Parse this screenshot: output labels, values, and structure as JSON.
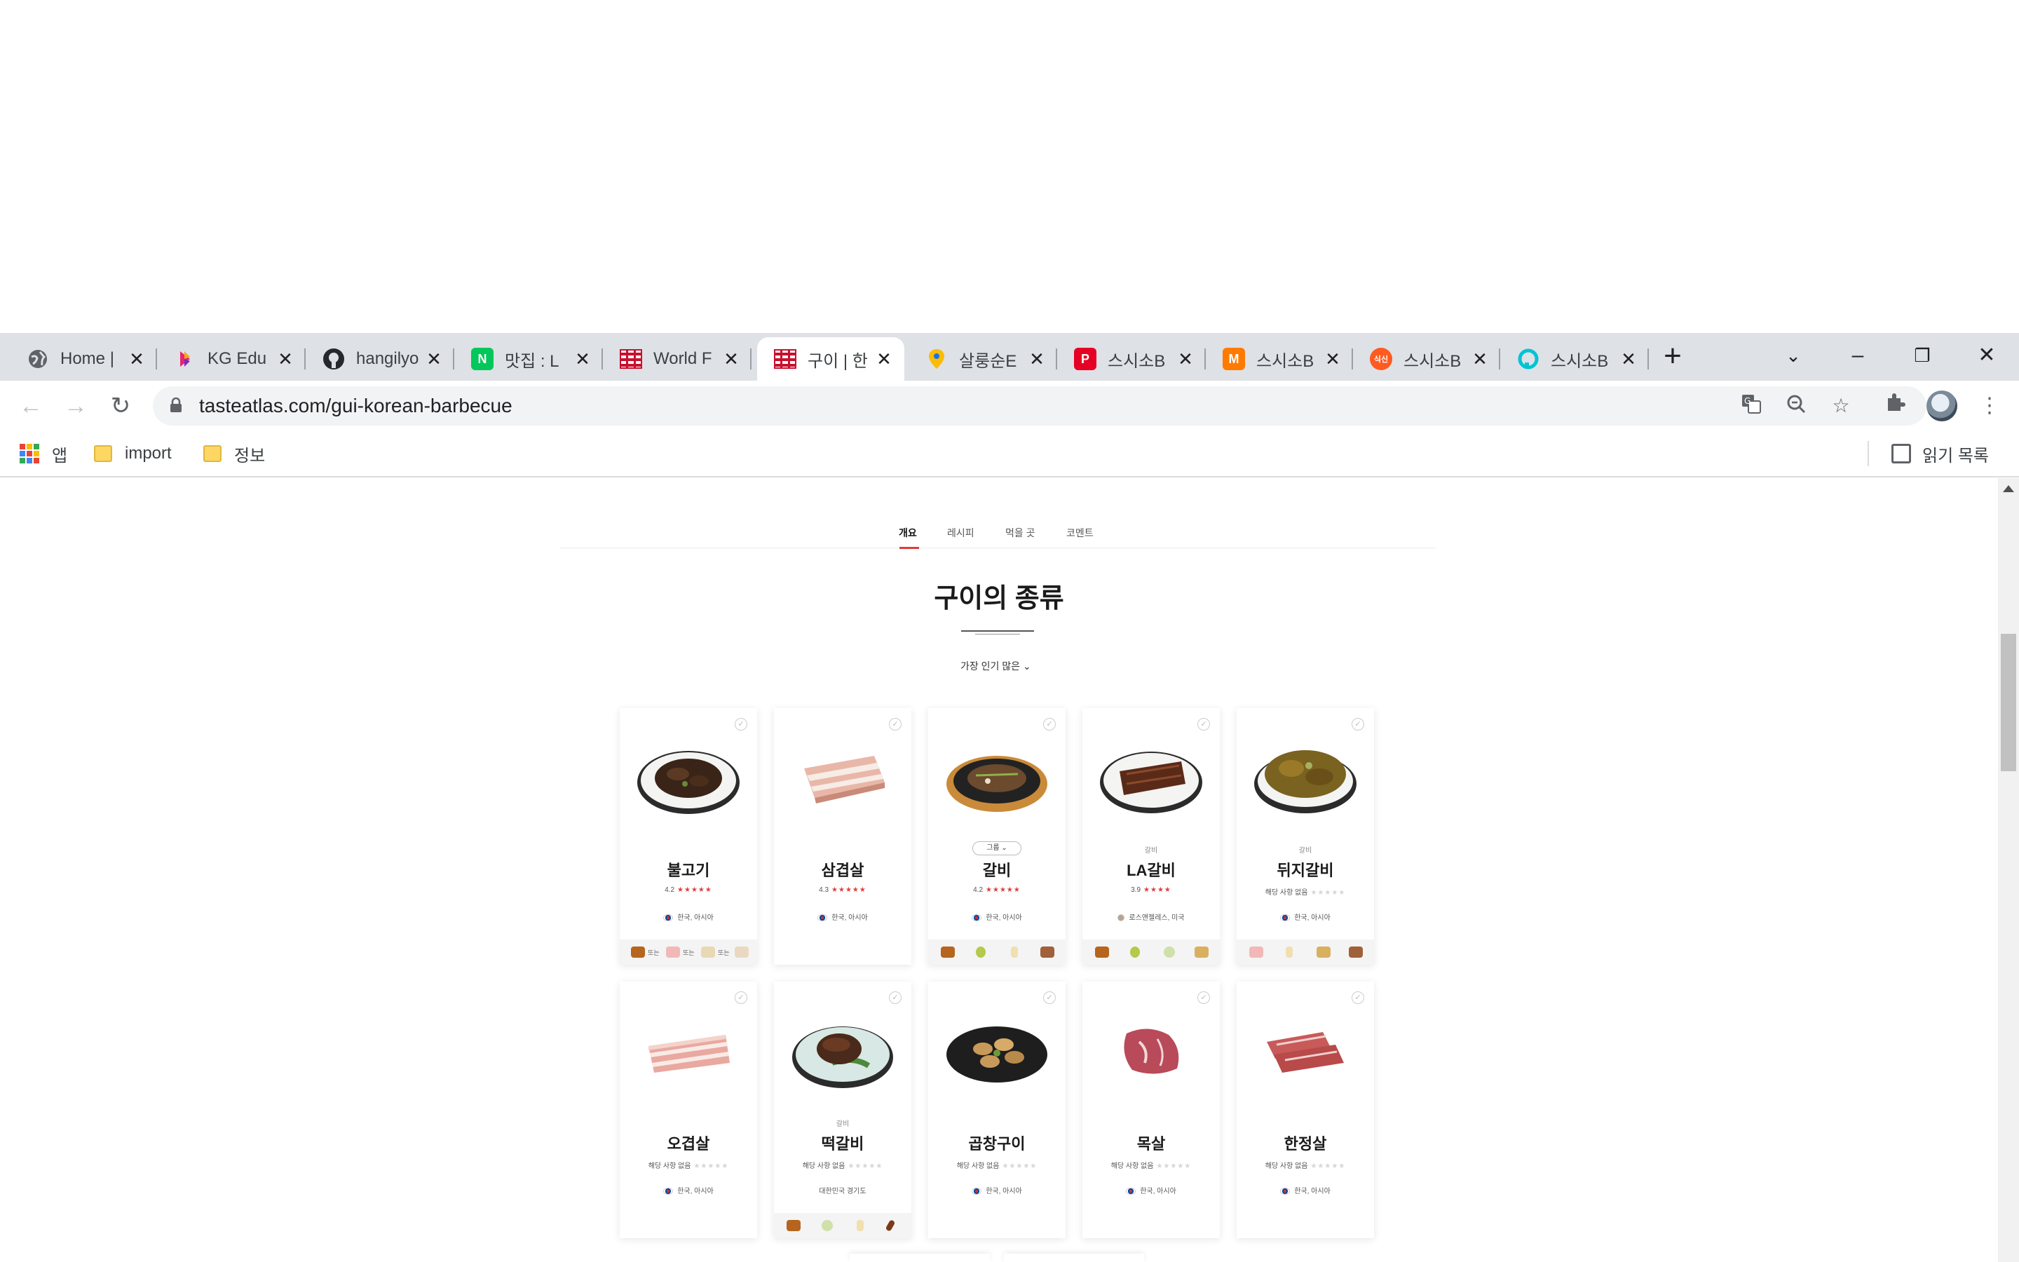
{
  "browser": {
    "tabs": [
      {
        "title": "Home |",
        "icon": "globe-icon",
        "color": "#5f6368"
      },
      {
        "title": "KG Edu",
        "icon": "kg-logo-icon",
        "color": "#e8256f"
      },
      {
        "title": "hangilyo",
        "icon": "github-icon",
        "color": "#24292e"
      },
      {
        "title": "맛집 : L",
        "icon": "naver-icon",
        "color": "#03c75a"
      },
      {
        "title": "World F",
        "icon": "tasteatlas-icon",
        "color": "#c8102e"
      },
      {
        "title": "구이 | 한",
        "icon": "tasteatlas-icon",
        "color": "#c8102e",
        "active": true
      },
      {
        "title": "살룽순E",
        "icon": "map-pin-icon",
        "color": "#fbbc04"
      },
      {
        "title": "스시소B",
        "icon": "p-logo-icon",
        "color": "#e60023"
      },
      {
        "title": "스시소B",
        "icon": "m-logo-icon",
        "color": "#ff7a00"
      },
      {
        "title": "스시소B",
        "icon": "siksin-logo-icon",
        "color": "#ff5a1f"
      },
      {
        "title": "스시소B",
        "icon": "d-logo-icon",
        "color": "#00c4d4"
      }
    ],
    "url": "tasteatlas.com/gui-korean-barbecue",
    "bookmarks": {
      "apps": "앱",
      "items": [
        "import",
        "정보"
      ],
      "reading_list": "읽기 목록"
    }
  },
  "page": {
    "subnav": [
      "개요",
      "레시피",
      "먹을 곳",
      "코멘트"
    ],
    "section_title": "구이의 종류",
    "sort_label": "가장 인기 많은",
    "cards": [
      {
        "name": "불고기",
        "rating": "4.2",
        "stars": "★★★★★",
        "origin": "한국, 아시아",
        "ingredients_text": [
          "또는",
          "또는",
          "또는"
        ]
      },
      {
        "name": "삼겹살",
        "rating": "4.3",
        "stars": "★★★★★",
        "origin": "한국, 아시아"
      },
      {
        "name": "갈비",
        "group": "그룹",
        "rating": "4.2",
        "stars": "★★★★★",
        "origin": "한국, 아시아"
      },
      {
        "name": "LA갈비",
        "parent": "갈비",
        "rating": "3.9",
        "stars": "★★★★",
        "origin": "로스앤젤레스, 미국"
      },
      {
        "name": "뒤지갈비",
        "parent": "갈비",
        "rating": "해당 사항 없음",
        "stars": "★★★★★",
        "origin": "한국, 아시아"
      },
      {
        "name": "오겹살",
        "rating": "해당 사항 없음",
        "stars": "★★★★★",
        "origin": "한국, 아시아"
      },
      {
        "name": "떡갈비",
        "parent": "갈비",
        "rating": "해당 사항 없음",
        "stars": "★★★★★",
        "origin": "대한민국 경기도"
      },
      {
        "name": "곱창구이",
        "rating": "해당 사항 없음",
        "stars": "★★★★★",
        "origin": "한국, 아시아"
      },
      {
        "name": "목살",
        "rating": "해당 사항 없음",
        "stars": "★★★★★",
        "origin": "한국, 아시아"
      },
      {
        "name": "한정살",
        "rating": "해당 사항 없음",
        "stars": "★★★★★",
        "origin": "한국, 아시아"
      }
    ]
  }
}
